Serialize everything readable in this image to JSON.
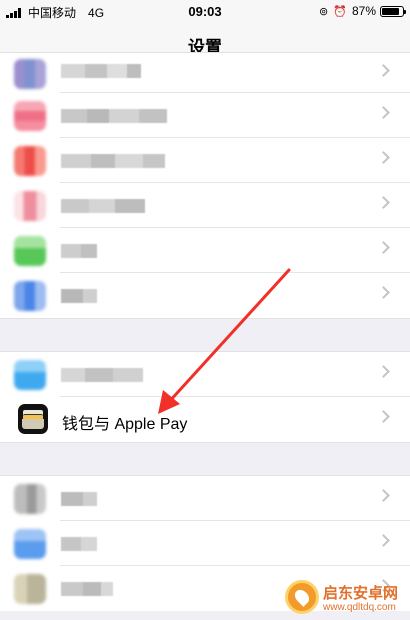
{
  "status_bar": {
    "carrier": "中国移动",
    "network": "4G",
    "time": "09:03",
    "lock_icon": "orientation-lock-icon",
    "alarm_icon": "alarm-icon",
    "battery_percent": "87%",
    "battery_level": 0.87
  },
  "nav": {
    "title": "设置"
  },
  "wallet_row": {
    "label": "钱包与 Apple Pay",
    "icon": "wallet-icon"
  },
  "annotation": {
    "color": "#f2302a"
  },
  "watermark": {
    "title": "启东安卓网",
    "url": "www.qdltdq.com"
  },
  "colors": {
    "background": "#f0eff5",
    "chevron": "#c4c4c8"
  }
}
